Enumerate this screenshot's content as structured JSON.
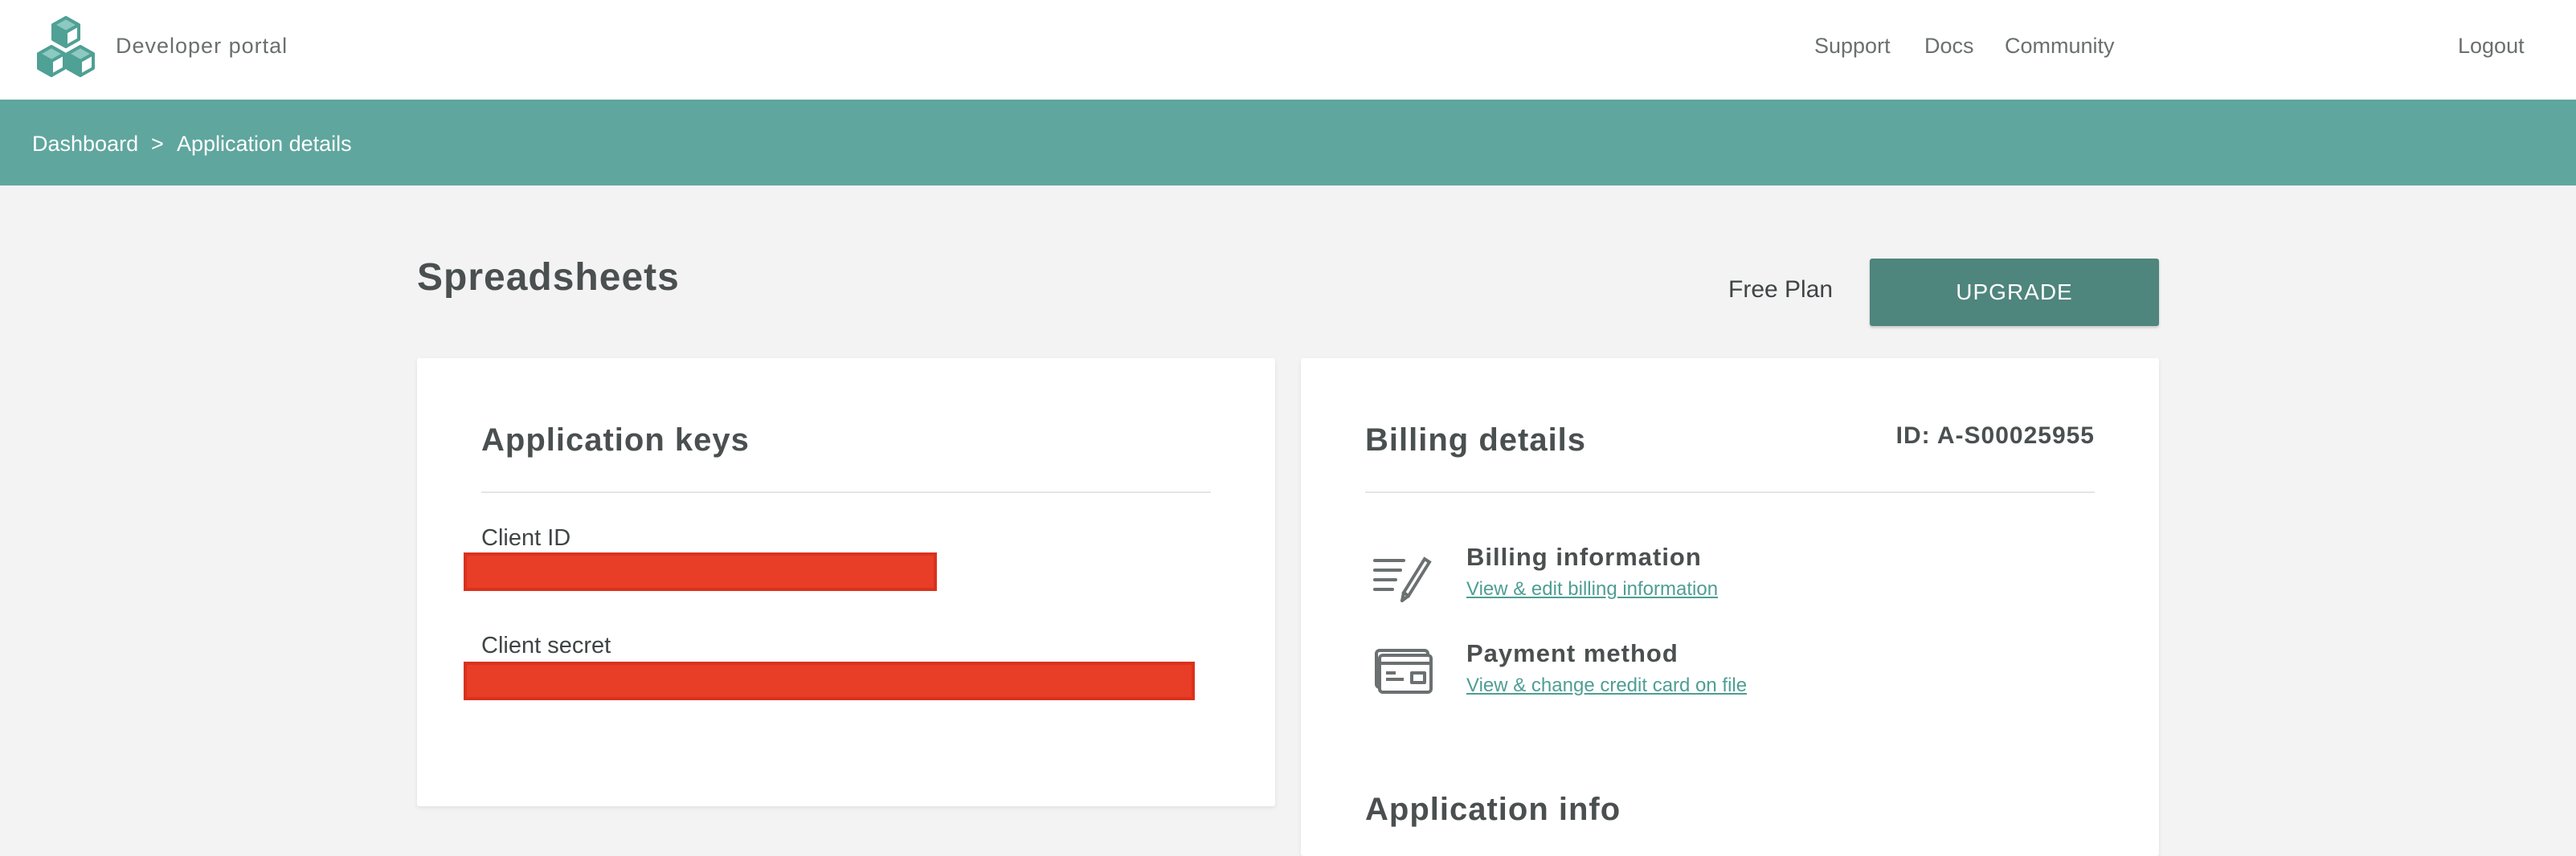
{
  "header": {
    "brand": "Developer portal",
    "nav": [
      {
        "label": "Support"
      },
      {
        "label": "Docs"
      },
      {
        "label": "Community"
      }
    ],
    "logout": "Logout"
  },
  "breadcrumb": {
    "items": [
      "Dashboard",
      "Application details"
    ],
    "separator": ">"
  },
  "page": {
    "title": "Spreadsheets",
    "plan": "Free Plan",
    "upgrade_label": "UPGRADE"
  },
  "app_keys": {
    "title": "Application keys",
    "client_id_label": "Client ID",
    "client_secret_label": "Client secret"
  },
  "billing": {
    "title": "Billing details",
    "id_text": "ID: A-S00025955",
    "items": [
      {
        "title": "Billing information",
        "link": "View & edit billing information",
        "icon": "pen-lines-icon"
      },
      {
        "title": "Payment method",
        "link": "View & change credit card on file",
        "icon": "credit-card-icon"
      }
    ],
    "next_section": "Application info"
  },
  "colors": {
    "accent": "#5fa69e",
    "button": "#4e857d",
    "link": "#4e9e94",
    "redaction": "#e83e27"
  }
}
